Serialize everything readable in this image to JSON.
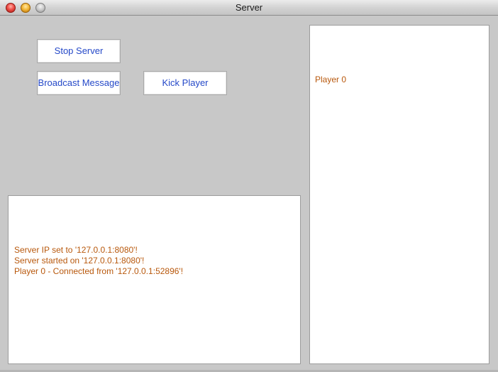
{
  "window": {
    "title": "Server"
  },
  "controls": {
    "stop_server_label": "Stop Server",
    "broadcast_label": "Broadcast Message",
    "kick_player_label": "Kick Player"
  },
  "log": {
    "lines": [
      "Server IP set to '127.0.0.1:8080'!",
      "Server started on '127.0.0.1:8080'!",
      "Player 0 - Connected from '127.0.0.1:52896'!"
    ]
  },
  "players": {
    "items": [
      "Player 0"
    ]
  },
  "colors": {
    "button_text": "#2448c8",
    "log_text": "#b8580c",
    "window_background": "#c8c8c8"
  }
}
